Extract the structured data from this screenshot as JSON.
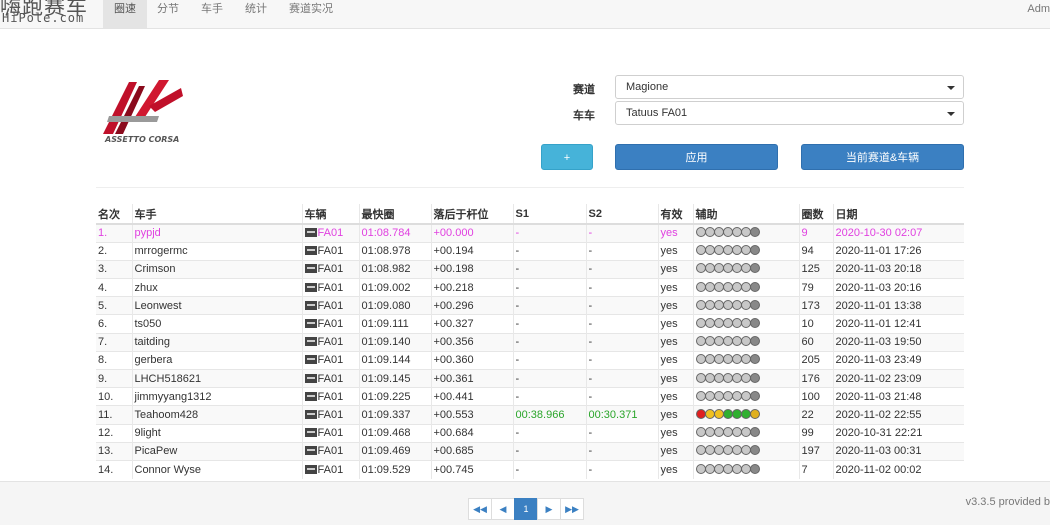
{
  "brand": {
    "cn": "嗨跑赛车",
    "en": "HiPole.com"
  },
  "nav": {
    "items": [
      {
        "label": "圈速",
        "active": true
      },
      {
        "label": "分节",
        "active": false
      },
      {
        "label": "车手",
        "active": false
      },
      {
        "label": "统计",
        "active": false
      },
      {
        "label": "赛道实况",
        "active": false
      }
    ],
    "right_label": "Adm"
  },
  "logo": {
    "text": "ASSETTO CORSA"
  },
  "form": {
    "track_label": "赛道",
    "track_value": "Magione",
    "car_label": "车车",
    "car_value": "Tatuus FA01",
    "plus_label": "+",
    "apply_label": "应用",
    "current_label": "当前赛道&车辆"
  },
  "table": {
    "headers": [
      "名次",
      "车手",
      "车辆",
      "最快圈",
      "落后于杆位",
      "S1",
      "S2",
      "有效",
      "辅助",
      "圈数",
      "日期"
    ],
    "rows": [
      {
        "pos": "1.",
        "driver": "pypjd",
        "car": "FA01",
        "best": "01:08.784",
        "gap": "+00.000",
        "s1": "-",
        "s2": "-",
        "valid": "yes",
        "laps": "9",
        "date": "2020-10-30 02:07"
      },
      {
        "pos": "2.",
        "driver": "mrrogermc",
        "car": "FA01",
        "best": "01:08.978",
        "gap": "+00.194",
        "s1": "-",
        "s2": "-",
        "valid": "yes",
        "laps": "94",
        "date": "2020-11-01 17:26"
      },
      {
        "pos": "3.",
        "driver": "Crimson",
        "car": "FA01",
        "best": "01:08.982",
        "gap": "+00.198",
        "s1": "-",
        "s2": "-",
        "valid": "yes",
        "laps": "125",
        "date": "2020-11-03 20:18"
      },
      {
        "pos": "4.",
        "driver": "zhux",
        "car": "FA01",
        "best": "01:09.002",
        "gap": "+00.218",
        "s1": "-",
        "s2": "-",
        "valid": "yes",
        "laps": "79",
        "date": "2020-11-03 20:16"
      },
      {
        "pos": "5.",
        "driver": "Leonwest",
        "car": "FA01",
        "best": "01:09.080",
        "gap": "+00.296",
        "s1": "-",
        "s2": "-",
        "valid": "yes",
        "laps": "173",
        "date": "2020-11-01 13:38"
      },
      {
        "pos": "6.",
        "driver": "ts050",
        "car": "FA01",
        "best": "01:09.111",
        "gap": "+00.327",
        "s1": "-",
        "s2": "-",
        "valid": "yes",
        "laps": "10",
        "date": "2020-11-01 12:41"
      },
      {
        "pos": "7.",
        "driver": "taitding",
        "car": "FA01",
        "best": "01:09.140",
        "gap": "+00.356",
        "s1": "-",
        "s2": "-",
        "valid": "yes",
        "laps": "60",
        "date": "2020-11-03 19:50"
      },
      {
        "pos": "8.",
        "driver": "gerbera",
        "car": "FA01",
        "best": "01:09.144",
        "gap": "+00.360",
        "s1": "-",
        "s2": "-",
        "valid": "yes",
        "laps": "205",
        "date": "2020-11-03 23:49"
      },
      {
        "pos": "9.",
        "driver": "LHCH518621",
        "car": "FA01",
        "best": "01:09.145",
        "gap": "+00.361",
        "s1": "-",
        "s2": "-",
        "valid": "yes",
        "laps": "176",
        "date": "2020-11-02 23:09"
      },
      {
        "pos": "10.",
        "driver": "jimmyyang1312",
        "car": "FA01",
        "best": "01:09.225",
        "gap": "+00.441",
        "s1": "-",
        "s2": "-",
        "valid": "yes",
        "laps": "100",
        "date": "2020-11-03 21:48"
      },
      {
        "pos": "11.",
        "driver": "Teahoom428",
        "car": "FA01",
        "best": "01:09.337",
        "gap": "+00.553",
        "s1": "00:38.966",
        "s2": "00:30.371",
        "valid": "yes",
        "laps": "22",
        "date": "2020-11-02 22:55"
      },
      {
        "pos": "12.",
        "driver": "9light",
        "car": "FA01",
        "best": "01:09.468",
        "gap": "+00.684",
        "s1": "-",
        "s2": "-",
        "valid": "yes",
        "laps": "99",
        "date": "2020-10-31 22:21"
      },
      {
        "pos": "13.",
        "driver": "PicaPew",
        "car": "FA01",
        "best": "01:09.469",
        "gap": "+00.685",
        "s1": "-",
        "s2": "-",
        "valid": "yes",
        "laps": "197",
        "date": "2020-11-03 00:31"
      },
      {
        "pos": "14.",
        "driver": "Connor Wyse",
        "car": "FA01",
        "best": "01:09.529",
        "gap": "+00.745",
        "s1": "-",
        "s2": "-",
        "valid": "yes",
        "laps": "7",
        "date": "2020-11-02 00:02"
      }
    ],
    "aid_colors_default": [
      "#c8c8c8",
      "#c8c8c8",
      "#c8c8c8",
      "#c8c8c8",
      "#c8c8c8",
      "#c8c8c8",
      "#888888"
    ],
    "aid_colors_row11": [
      "#e02020",
      "#f0c020",
      "#f0c020",
      "#30b030",
      "#30b030",
      "#30b030",
      "#e0b020"
    ]
  },
  "pager": {
    "first_icon": "first-page-icon",
    "prev_icon": "prev-page-icon",
    "current": "1",
    "next_icon": "next-page-icon",
    "last_icon": "last-page-icon"
  },
  "footer": {
    "version": "v3.3.5 provided b"
  }
}
